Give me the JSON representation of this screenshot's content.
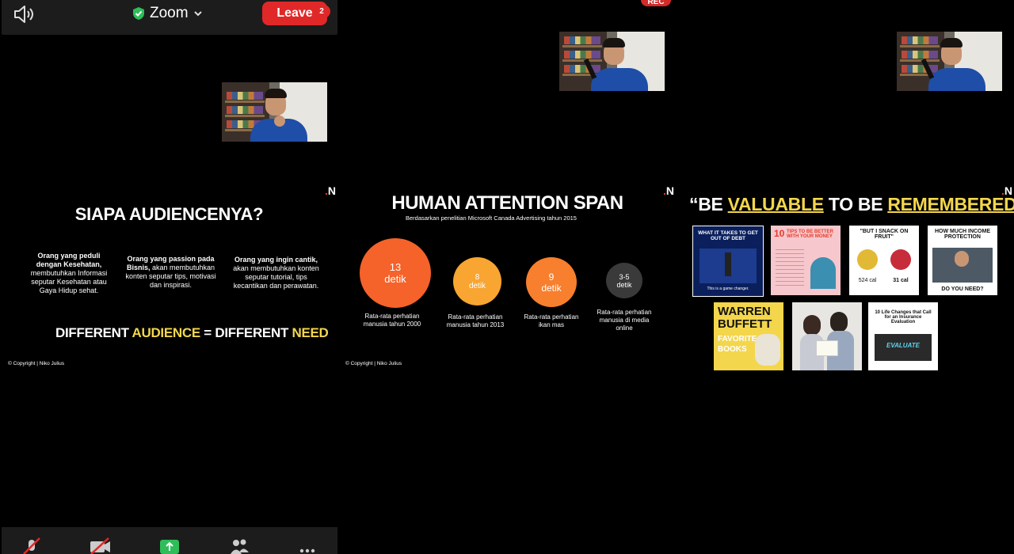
{
  "header": {
    "app_title": "Zoom",
    "leave_label": "Leave",
    "rec_label": "REC"
  },
  "toolbar": {
    "participants_badge": "2"
  },
  "slide1": {
    "logo": "N",
    "title": "SIAPA AUDIENCENYA?",
    "columns": [
      {
        "bold": "Orang yang peduli dengan Kesehatan,",
        "text": "membutuhkan Informasi seputar Kesehatan atau Gaya Hidup sehat."
      },
      {
        "bold": "Orang yang passion pada Bisnis,",
        "text": "akan membutuhkan konten seputar tips, motivasi dan inspirasi."
      },
      {
        "bold": "Orang yang ingin cantik,",
        "text": "akan membutuhkan konten seputar tutorial, tips kecantikan dan perawatan."
      }
    ],
    "tagline": {
      "part1": "DIFFERENT ",
      "part2": "AUDIENCE",
      "part3": " = DIFFERENT ",
      "part4": "NEED"
    },
    "copyright": "© Copyright | Niko Julius"
  },
  "slide2": {
    "logo": "N",
    "title": "HUMAN ATTENTION SPAN",
    "subtitle": "Berdasarkan penelitian Microsoft Canada Advertising tahun 2015",
    "circles": [
      {
        "value": "13",
        "unit": "detik",
        "caption": "Rata-rata perhatian manusia tahun 2000",
        "color": "#f5622a"
      },
      {
        "value": "8",
        "unit": "detik",
        "caption": "Rata-rata perhatian manusia tahun 2013",
        "color": "#f8a531"
      },
      {
        "value": "9",
        "unit": "detik",
        "caption": "Rata-rata perhatian ikan mas",
        "color": "#f77f2d"
      },
      {
        "value": "3-5",
        "unit": "detik",
        "caption": "Rata-rata perhatian manusia di media online",
        "color": "#3a3a3a"
      }
    ],
    "copyright": "© Copyright | Niko Julius"
  },
  "slide3": {
    "logo": "N",
    "title": {
      "q1": "“BE ",
      "w1": "VALUABLE",
      "q2": " TO BE ",
      "w2": "REMEMBERED",
      "q3": "”"
    },
    "thumbs": [
      {
        "text": "WHAT IT TAKES TO GET OUT OF DEBT",
        "caption": "This is a game changer."
      },
      {
        "text": "TIPS TO BE BETTER WITH YOUR MONEY",
        "number": "10"
      },
      {
        "text": "\"BUT I SNACK ON FRUIT\"",
        "left_value": "524 cal",
        "right_value": "31 cal"
      },
      {
        "text": "HOW MUCH INCOME PROTECTION",
        "bottom": "DO YOU NEED?"
      },
      {
        "line1": "WARREN",
        "line2": "BUFFETT",
        "line3": "FAVORITE",
        "line4": "BOOKS"
      },
      {
        "text": ""
      },
      {
        "text": "10 Life Changes that Call for an Insurance Evaluation",
        "sub": "EVALUATE"
      }
    ]
  },
  "colors": {
    "accent_yellow": "#f3d64c",
    "leave_red": "#e02828",
    "logo_red": "#e53b2a"
  }
}
